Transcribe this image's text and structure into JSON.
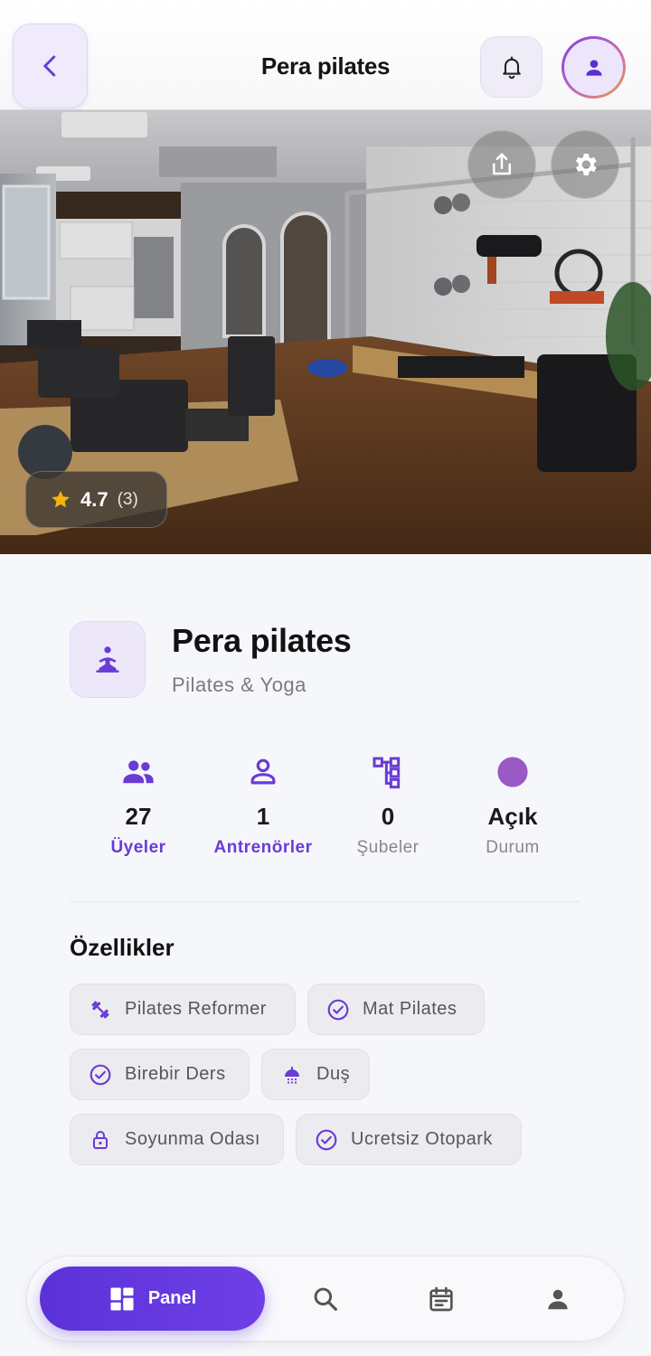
{
  "header": {
    "title": "Pera pilates"
  },
  "hero": {
    "rating_value": "4.7",
    "rating_count": "(3)"
  },
  "studio": {
    "name": "Pera pilates",
    "category": "Pilates & Yoga"
  },
  "stats": [
    {
      "value": "27",
      "label": "Üyeler",
      "icon": "members-icon"
    },
    {
      "value": "1",
      "label": "Antrenörler",
      "icon": "trainer-icon"
    },
    {
      "value": "0",
      "label": "Şubeler",
      "icon": "branches-icon"
    },
    {
      "value": "Açık",
      "label": "Durum",
      "icon": "status-dot-icon"
    }
  ],
  "features": {
    "title": "Özellikler",
    "items": [
      {
        "label": "Pilates Reformer",
        "icon": "dumbbell-icon"
      },
      {
        "label": "Mat Pilates",
        "icon": "check-circle-icon"
      },
      {
        "label": "Birebir Ders",
        "icon": "check-circle-icon"
      },
      {
        "label": "Duş",
        "icon": "shower-icon"
      },
      {
        "label": "Soyunma Odası",
        "icon": "lock-icon"
      },
      {
        "label": "Ucretsiz Otopark",
        "icon": "check-circle-icon"
      }
    ]
  },
  "bottom_nav": {
    "active_label": "Panel",
    "items": [
      "dashboard-icon",
      "search-icon",
      "calendar-icon",
      "profile-icon"
    ]
  },
  "colors": {
    "accent": "#6a3bd6",
    "status_open": "#9b59c6",
    "background": "#f6f7fb",
    "star": "#f5b50a"
  }
}
